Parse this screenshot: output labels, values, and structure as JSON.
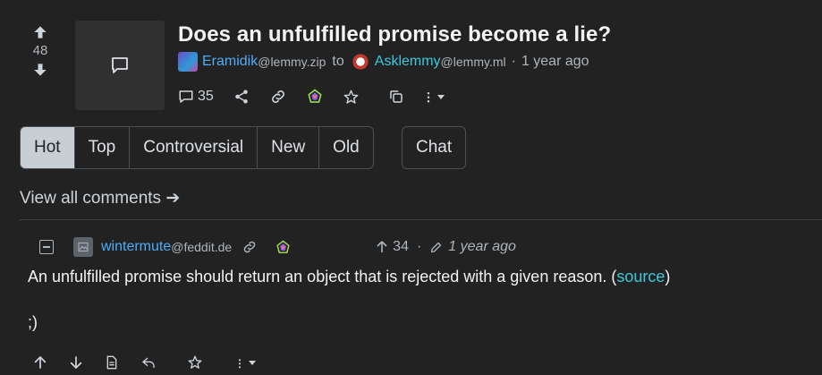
{
  "post": {
    "score": "48",
    "title": "Does an unfulfilled promise become a lie?",
    "author": "Eramidik",
    "author_instance": "@lemmy.zip",
    "to_word": "to",
    "community": "Asklemmy",
    "community_instance": "@lemmy.ml",
    "separator": "·",
    "time": "1 year ago",
    "comment_count": "35"
  },
  "sort": {
    "tabs": [
      {
        "label": "Hot",
        "active": true
      },
      {
        "label": "Top"
      },
      {
        "label": "Controversial"
      },
      {
        "label": "New"
      },
      {
        "label": "Old"
      }
    ],
    "chat_label": "Chat"
  },
  "view_all": "View all comments ➔",
  "comment": {
    "author": "wintermute",
    "author_instance": "@feddit.de",
    "score": "34",
    "separator": "·",
    "time": "1 year ago",
    "body_text": "An unfulfilled promise should return an object that is rejected with a given reason. (",
    "body_link": "source",
    "body_close": ")",
    "body_line2": ";)"
  },
  "colors": {
    "accent_link": "#4dabf7",
    "community_link": "#3bc9db",
    "background": "#222222"
  }
}
